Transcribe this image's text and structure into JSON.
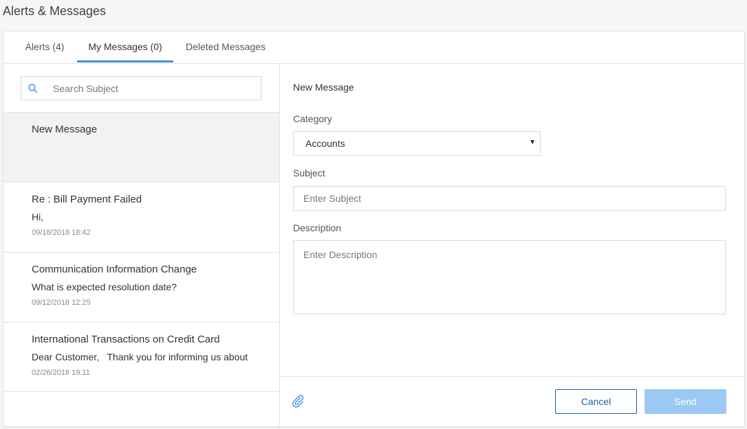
{
  "page": {
    "title": "Alerts & Messages"
  },
  "tabs": [
    {
      "label": "Alerts (4)"
    },
    {
      "label": "My Messages (0)"
    },
    {
      "label": "Deleted Messages"
    }
  ],
  "search": {
    "placeholder": "Search Subject",
    "icon": "search-icon"
  },
  "messages": [
    {
      "subject": "New Message",
      "preview": "",
      "date": ""
    },
    {
      "subject": "Re : Bill Payment Failed",
      "preview": "Hi,",
      "date": "09/18/2018 18:42"
    },
    {
      "subject": "Communication Information Change",
      "preview": "What is expected resolution date?",
      "date": "09/12/2018 12:25"
    },
    {
      "subject": "International Transactions on Credit Card",
      "preview": "Dear Customer,   Thank you for informing us about",
      "date": "02/26/2018 19:11"
    }
  ],
  "form": {
    "title": "New Message",
    "category_label": "Category",
    "category_value": "Accounts",
    "subject_label": "Subject",
    "subject_placeholder": "Enter Subject",
    "description_label": "Description",
    "description_placeholder": "Enter Description"
  },
  "footer": {
    "cancel_label": "Cancel",
    "send_label": "Send",
    "attach_icon": "paperclip-icon"
  },
  "colors": {
    "accent": "#3a8ee6",
    "cancel_border": "#1f5ea8",
    "send_disabled": "#9cc9f3"
  }
}
